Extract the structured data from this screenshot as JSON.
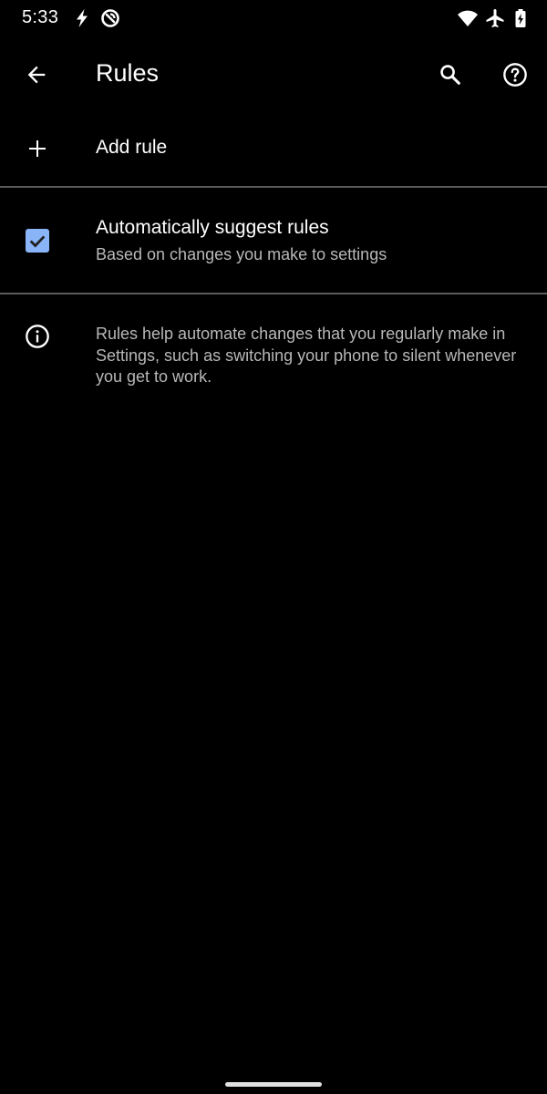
{
  "status_bar": {
    "time": "5:33",
    "icons": [
      "flash-icon",
      "data-saver-icon",
      "wifi-icon",
      "airplane-mode-icon",
      "battery-charging-icon"
    ]
  },
  "toolbar": {
    "title": "Rules",
    "back_icon": "arrow-back-icon",
    "search_icon": "search-icon",
    "help_icon": "help-icon"
  },
  "add_rule": {
    "label": "Add rule",
    "icon": "plus-icon"
  },
  "suggest_rules": {
    "title": "Automatically suggest rules",
    "subtitle": "Based on changes you make to settings",
    "checked": true,
    "checkbox_color": "#8ab4f8"
  },
  "info": {
    "icon": "info-icon",
    "text": "Rules help automate changes that you regularly make in Settings, such as switching your phone to silent whenever you get to work."
  },
  "theme": {
    "background": "#000000",
    "text_primary": "#ffffff",
    "text_secondary": "#b8b8b8",
    "divider": "#5a5a5a",
    "accent": "#8ab4f8"
  }
}
